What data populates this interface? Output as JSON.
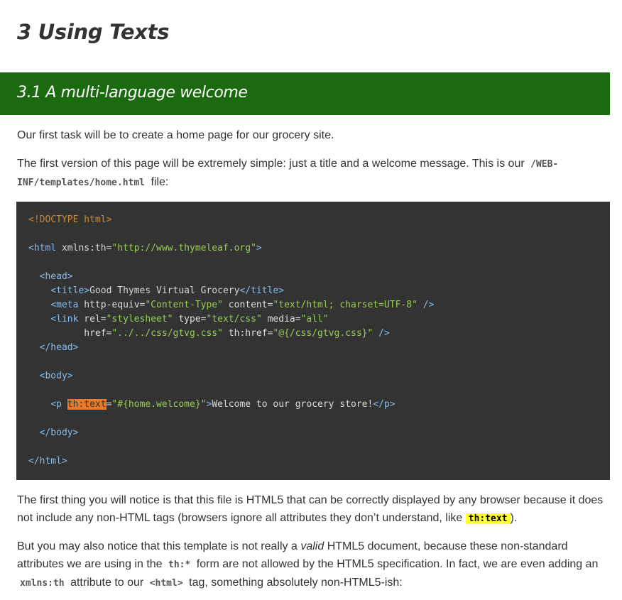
{
  "page_title": "3 Using Texts",
  "section_title": "3.1 A multi-language welcome",
  "p1": "Our first task will be to create a home page for our grocery site.",
  "p2": {
    "before": "The first version of this page will be extremely simple: just a title and a welcome message. This is our",
    "code": "/WEB-INF/templates/home.html",
    "after": "file:"
  },
  "code": {
    "doctype": "<!DOCTYPE html>",
    "html_open": "<html",
    "html_xmlns_attr": "xmlns:th",
    "html_xmlns_val": "\"http://www.thymeleaf.org\"",
    "head_open": "<head>",
    "title_open": "<title>",
    "title_text": "Good Thymes Virtual Grocery",
    "title_close": "</title>",
    "meta_open": "<meta",
    "meta_attr1": "http-equiv",
    "meta_val1": "\"Content-Type\"",
    "meta_attr2": "content",
    "meta_val2": "\"text/html; charset=UTF-8\"",
    "self_close": "/>",
    "link_open": "<link",
    "link_attr1": "rel",
    "link_val1": "\"stylesheet\"",
    "link_attr2": "type",
    "link_val2": "\"text/css\"",
    "link_attr3": "media",
    "link_val3": "\"all\"",
    "link_attr4": "href",
    "link_val4": "\"../../css/gtvg.css\"",
    "link_attr5": "th:href",
    "link_val5": "\"@{/css/gtvg.css}\"",
    "head_close": "</head>",
    "body_open": "<body>",
    "p_open": "<p",
    "p_attr": "th:text",
    "p_val": "\"#{home.welcome}\"",
    "p_text": "Welcome to our grocery store!",
    "p_close": "</p>",
    "body_close": "</body>",
    "html_close": "</html>"
  },
  "p3": {
    "before": "The first thing you will notice is that this file is HTML5 that can be correctly displayed by any browser because it does not include any non-HTML tags (browsers ignore all attributes they don’t understand, like",
    "code": "th:text",
    "after": ")."
  },
  "p4": {
    "s1": "But you may also notice that this template is not really a",
    "em": "valid",
    "s2": "HTML5 document, because these non-standard attributes we are using in the",
    "c1": "th:*",
    "s3": "form are not allowed by the HTML5 specification. In fact, we are even adding an",
    "c2": "xmlns:th",
    "s4": "attribute to our",
    "c3": "<html>",
    "s5": "tag, something absolutely non-HTML5-ish:"
  },
  "colors": {
    "section_bar": "#1b6a10",
    "code_bg": "#333333",
    "highlight_inline": "#ffff33",
    "highlight_code": "#e87a2a"
  }
}
